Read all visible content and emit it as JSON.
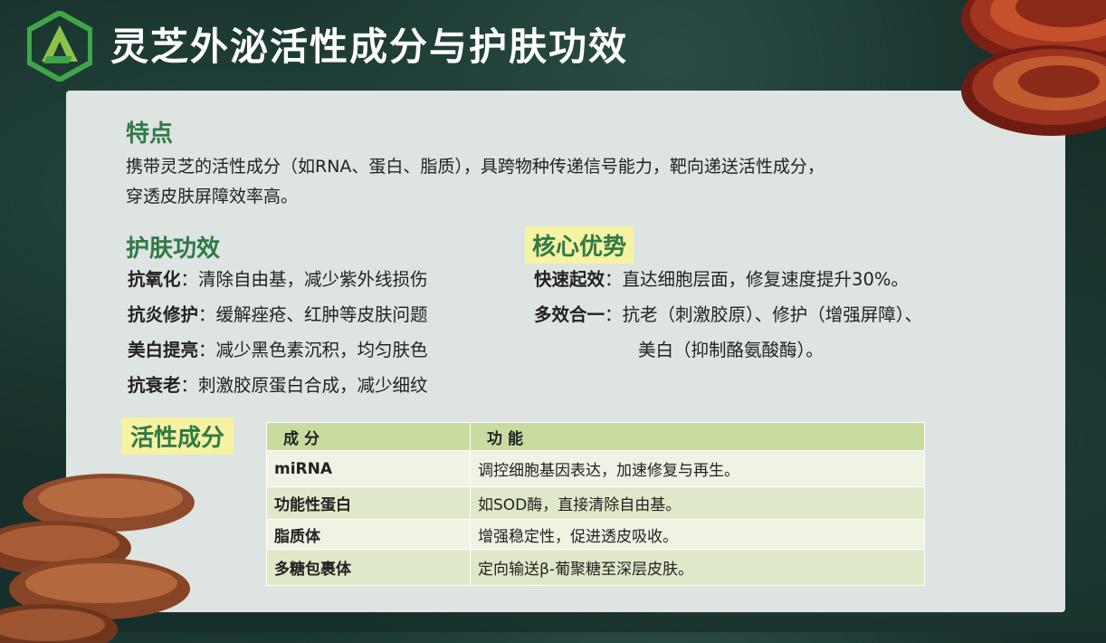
{
  "header": {
    "title": "灵芝外泌活性成分与护肤功效"
  },
  "features": {
    "heading": "特点",
    "text_line1": "携带灵芝的活性成分（如RNA、蛋白、脂质），具跨物种传递信号能力，靶向递送活性成分，",
    "text_line2": "穿透皮肤屏障效率高。"
  },
  "skincare": {
    "heading": "护肤功效",
    "items": [
      {
        "label": "抗氧化",
        "sep": "：",
        "desc": "清除自由基，减少紫外线损伤"
      },
      {
        "label": "抗炎修护",
        "sep": "：",
        "desc": "缓解痤疮、红肿等皮肤问题"
      },
      {
        "label": "美白提亮",
        "sep": "：",
        "desc": "减少黑色素沉积，均匀肤色"
      },
      {
        "label": "抗衰老",
        "sep": "：",
        "desc": "刺激胶原蛋白合成，减少细纹"
      }
    ]
  },
  "advantages": {
    "heading": "核心优势",
    "items": [
      {
        "label": "快速起效",
        "sep": "：",
        "desc": "直达细胞层面，修复速度提升30%。"
      },
      {
        "label": "多效合一",
        "sep": "：",
        "desc": "抗老（刺激胶原）、修护（增强屏障）、"
      }
    ],
    "continuation": "美白（抑制酪氨酸酶）。"
  },
  "active": {
    "heading": "活性成分",
    "table": {
      "headers": [
        "成分",
        "功能"
      ],
      "rows": [
        [
          "miRNA",
          "调控细胞基因表达，加速修复与再生。"
        ],
        [
          "功能性蛋白",
          "如SOD酶，直接清除自由基。"
        ],
        [
          "脂质体",
          "增强稳定性，促进透皮吸收。"
        ],
        [
          "多糖包裹体",
          "定向输送β-葡聚糖至深层皮肤。"
        ]
      ]
    }
  }
}
